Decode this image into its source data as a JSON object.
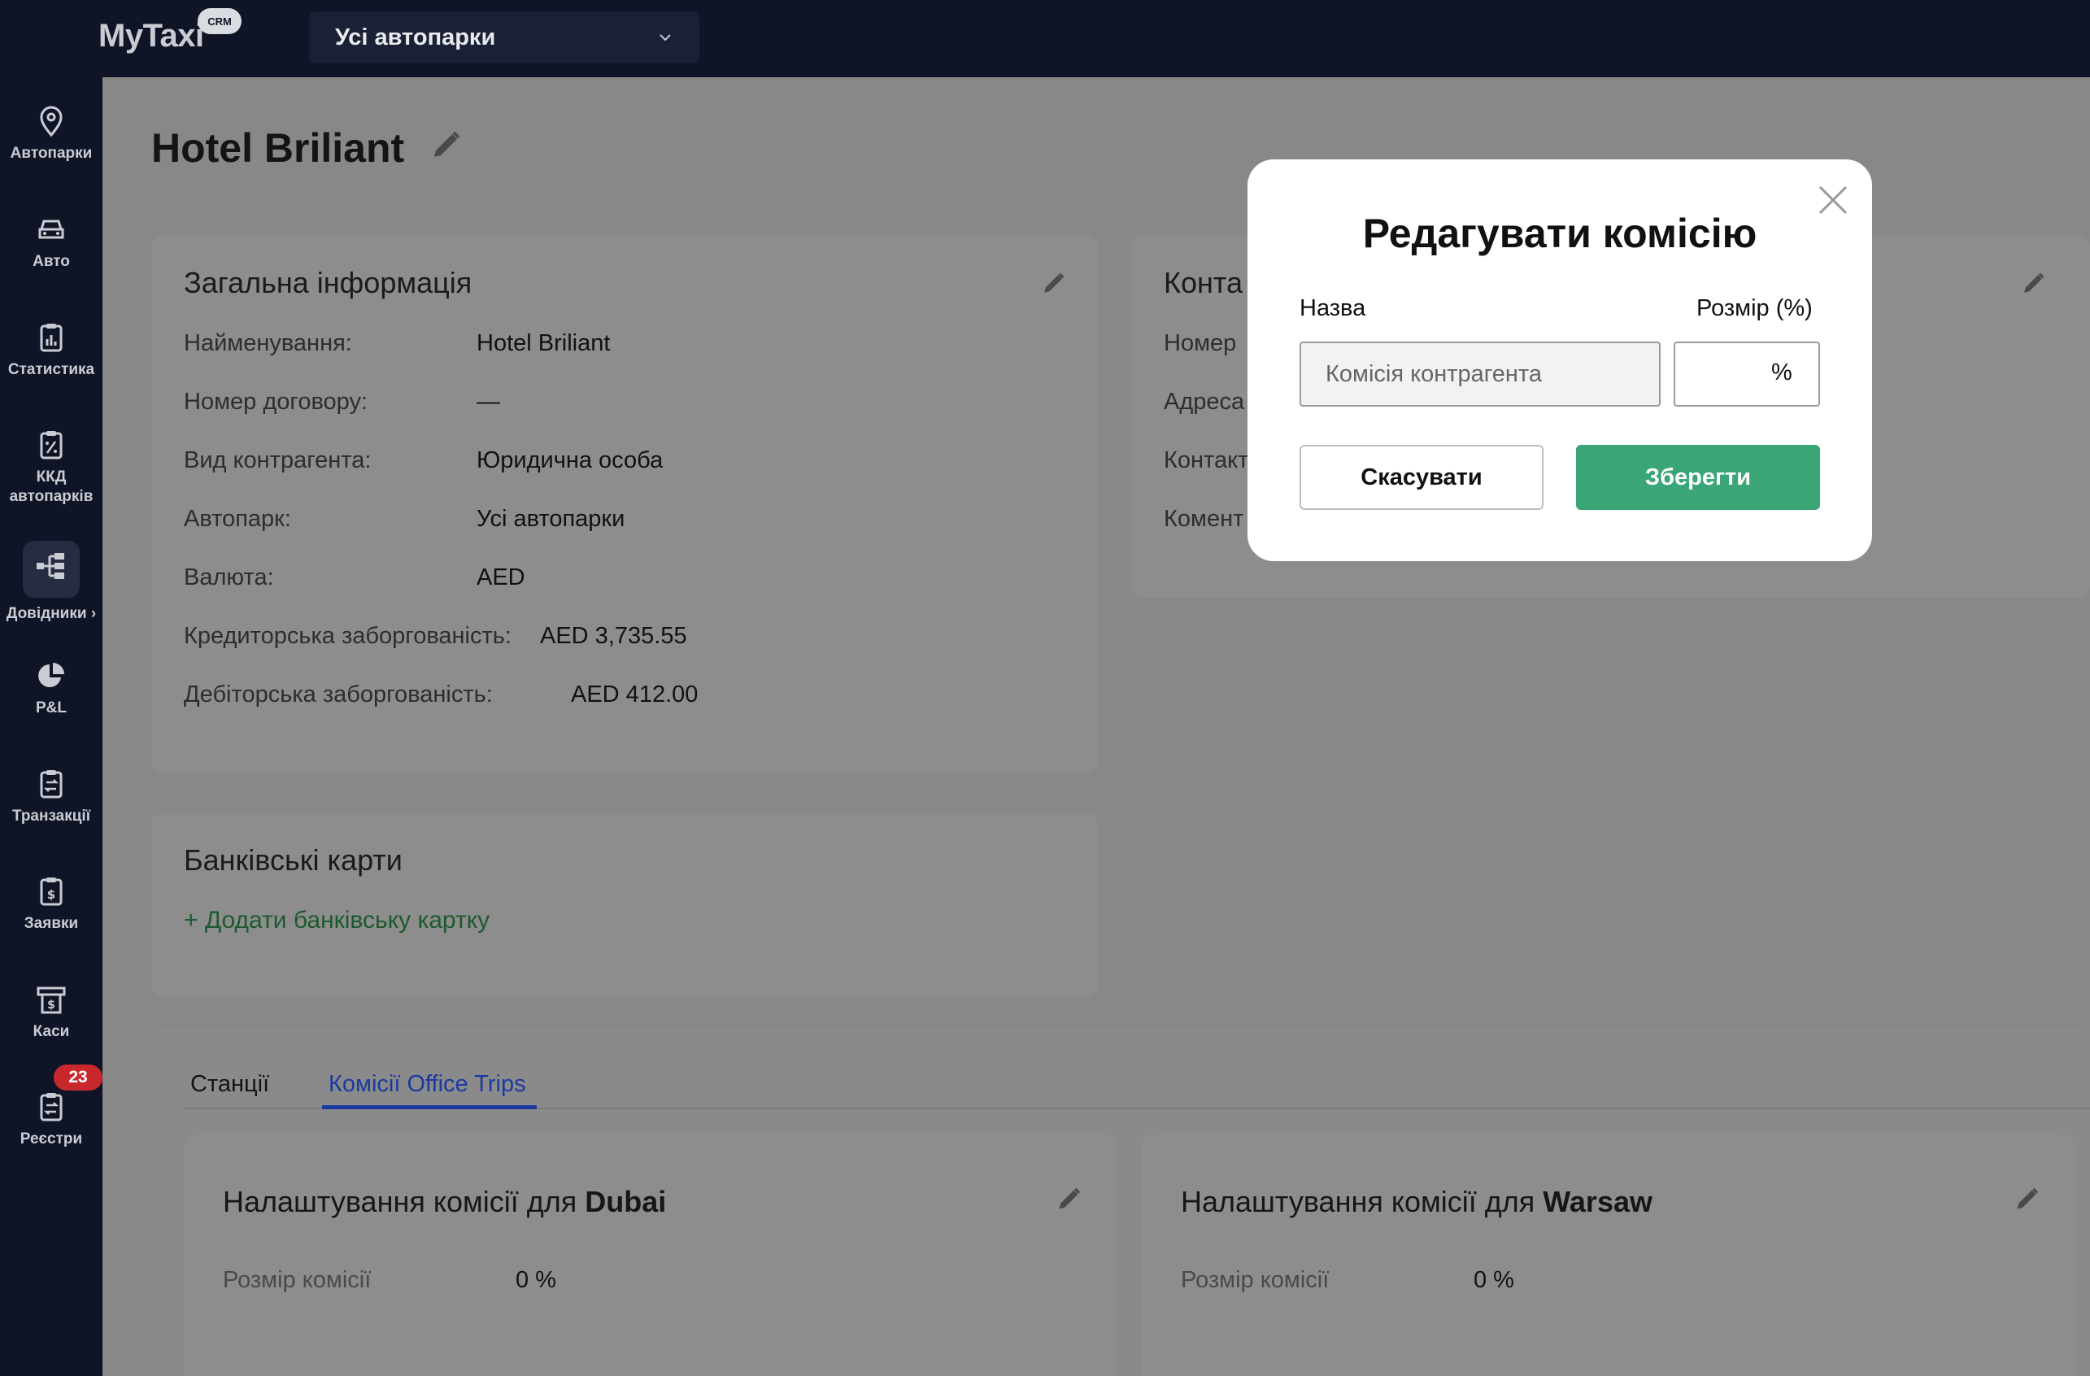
{
  "app": {
    "logo": "MyTaxi",
    "logo_badge": "CRM"
  },
  "header": {
    "fleet_select": "Усі автопарки"
  },
  "sidebar": {
    "items": [
      {
        "label": "Автопарки"
      },
      {
        "label": "Авто"
      },
      {
        "label": "Статистика"
      },
      {
        "label": "ККД автопарків"
      },
      {
        "label": "Довідники"
      },
      {
        "label": "P&L"
      },
      {
        "label": "Транзакції"
      },
      {
        "label": "Заявки"
      },
      {
        "label": "Каси"
      },
      {
        "label": "Реєстри"
      }
    ],
    "registry_badge": "23"
  },
  "page": {
    "title": "Hotel Briliant"
  },
  "general_info": {
    "title": "Загальна інформація",
    "rows": [
      {
        "label": "Найменування:",
        "value": "Hotel Briliant"
      },
      {
        "label": "Номер договору:",
        "value": "—"
      },
      {
        "label": "Вид контрагента:",
        "value": "Юридична особа"
      },
      {
        "label": "Автопарк:",
        "value": "Усі автопарки"
      },
      {
        "label": "Валюта:",
        "value": "AED"
      },
      {
        "label": "Кредиторська заборгованість:",
        "value": "AED 3,735.55"
      },
      {
        "label": "Дебіторська заборгованість:",
        "value": "AED 412.00"
      }
    ]
  },
  "contacts": {
    "title_partial": "Конта",
    "labels": [
      "Номер",
      "Адреса",
      "Контакт",
      "Комент"
    ]
  },
  "bank_cards": {
    "title": "Банківські карти",
    "add_link": "+ Додати банківську картку"
  },
  "tabs": [
    {
      "label": "Станції"
    },
    {
      "label": "Комісії Office Trips"
    }
  ],
  "commissions": [
    {
      "prefix": "Налаштування комісії для ",
      "city": "Dubai",
      "label": "Розмір комісії",
      "value": "0 %"
    },
    {
      "prefix": "Налаштування комісії для ",
      "city": "Warsaw",
      "label": "Розмір комісії",
      "value": "0 %"
    }
  ],
  "modal": {
    "title": "Редагувати комісію",
    "name_label": "Назва",
    "size_label": "Розмір (%)",
    "name_placeholder": "Комісія контрагента",
    "percent_sign": "%",
    "cancel": "Скасувати",
    "save": "Зберегти"
  },
  "colors": {
    "accent_green": "#3aa576",
    "tab_active": "#1b3aa0",
    "badge_red": "#c8282c",
    "sidebar_bg": "#0f1526"
  }
}
